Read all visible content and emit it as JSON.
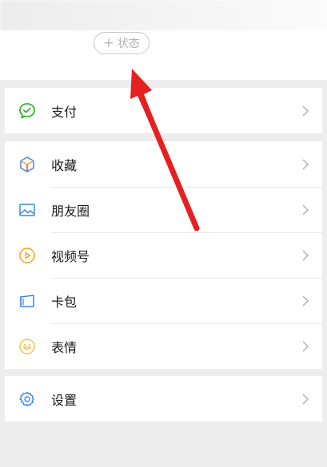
{
  "status": {
    "plus": "+",
    "label": "状态"
  },
  "menu": {
    "pay": "支付",
    "favorites": "收藏",
    "moments": "朋友圈",
    "channels": "视频号",
    "cards": "卡包",
    "stickers": "表情",
    "settings": "设置"
  },
  "colors": {
    "green": "#1aad19",
    "blue": "#3d86e6",
    "orange": "#f5a623",
    "yellow": "#f7c342",
    "arrow_red": "#e62020"
  }
}
